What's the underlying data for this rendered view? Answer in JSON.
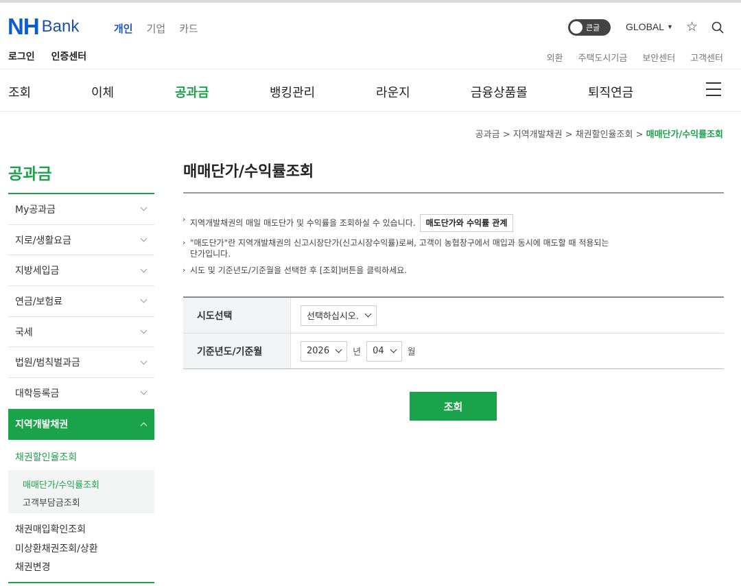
{
  "header": {
    "logo_nh": "NH",
    "logo_bank": "Bank",
    "segments": [
      "개인",
      "기업",
      "카드"
    ],
    "toggle_label": "큰글",
    "global_label": "GLOBAL",
    "login": "로그인",
    "cert_center": "인증센터",
    "util_links": [
      "외환",
      "주택도시기금",
      "보안센터",
      "고객센터"
    ]
  },
  "gnb": [
    "조회",
    "이체",
    "공과금",
    "뱅킹관리",
    "라운지",
    "금융상품몰",
    "퇴직연금"
  ],
  "breadcrumb": {
    "items": [
      "공과금",
      "지역개발채권",
      "채권할인율조회"
    ],
    "separator": ">",
    "current": "매매단가/수익률조회"
  },
  "sidebar": {
    "title": "공과금",
    "items": [
      "My공과금",
      "지로/생활요금",
      "지방세입금",
      "연금/보험료",
      "국세",
      "법원/범칙벌과금",
      "대학등록금",
      "지역개발채권"
    ],
    "sub_first": "채권할인율조회",
    "sub_box": [
      "매매단가/수익률조회",
      "고객부담금조회"
    ],
    "sub_rest": [
      "채권매입확인조회",
      "미상환채권조회/상환",
      "채권변경"
    ]
  },
  "main": {
    "title": "매매단가/수익률조회",
    "note1": "지역개발채권의 매일 매도단가 및 수익률을 조회하실 수 있습니다.",
    "note1_button": "매도단가와 수익률 관계",
    "note2_line1": "\"매도단가\"란 지역개발채권의 신고시장단가(신고시장수익률)로써, 고객이 농협창구에서 매입과 동시에 매도할 때 적용되는",
    "note2_line2": "단가입니다.",
    "note3": "시도 및 기준년도/기준월을 선택한 후 [조회]버튼을 클릭하세요.",
    "form": {
      "row1_label": "시도선택",
      "row1_select": "선택하십시오.",
      "row2_label": "기준년도/기준월",
      "year": "2026",
      "year_unit": "년",
      "month": "04",
      "month_unit": "월"
    },
    "search_button": "조회"
  },
  "colors": {
    "brand_green": "#1aa34a",
    "brand_blue": "#0b5bd3"
  }
}
